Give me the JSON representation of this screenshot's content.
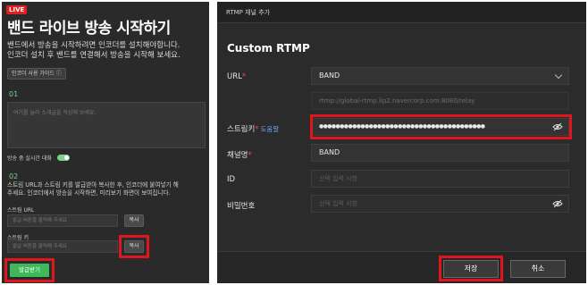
{
  "left": {
    "live_badge": "LIVE",
    "title": "밴드 라이브 방송 시작하기",
    "desc_line1": "밴드에서 방송을 시작하려면 인코더를 설치해야합니다.",
    "desc_line2": "인코더 설치 후 밴드를 연결해서 방송을 시작해 보세요.",
    "guide_button": "인코더 사용 가이드 ⓘ",
    "step1_number": "01",
    "memo_placeholder": "여기를 눌러 소개글을 작성해 보세요.",
    "chat_toggle_label": "방송 중 실시간 대화",
    "chat_toggle_on": true,
    "step2_number": "02",
    "step2_line1": "스트림 URL과 스트림 키를 발급받아 복사한 후, 인코더에 붙여넣기 해",
    "step2_line2": "주세요. 인코더에서 방송을 시작하면, 미리보기 화면이 보여집니다.",
    "stream_url_label": "스트림 URL",
    "stream_url_placeholder": "발급 버튼을 클릭해 주세요",
    "stream_key_label": "스트림 키",
    "stream_key_placeholder": "발급 버튼을 클릭해 주세요",
    "copy_label": "복사",
    "issue_button": "발급받기",
    "highlight_color": "#e0161e",
    "accent_color": "#3db85a"
  },
  "right": {
    "header_title": "RTMP 채널 추가",
    "section_title": "Custom RTMP",
    "url_label": "URL",
    "url_select_value": "BAND",
    "url_value": "rtmp://global-rtmp.lip2.navercorp.com:8080/relay",
    "stream_key_label": "스트림키",
    "help_link": "도움말",
    "stream_key_value": "●●●●●●●●●●●●●●●●●●●●●●●●●●●●●●●●●●●●●●●●",
    "channel_name_label": "채널명",
    "channel_name_value": "BAND",
    "id_label": "ID",
    "id_placeholder": "선택 입력 사항",
    "password_label": "비밀번호",
    "password_placeholder": "선택 입력 사항",
    "save_button": "저장",
    "cancel_button": "취소",
    "required_marker": "*"
  }
}
